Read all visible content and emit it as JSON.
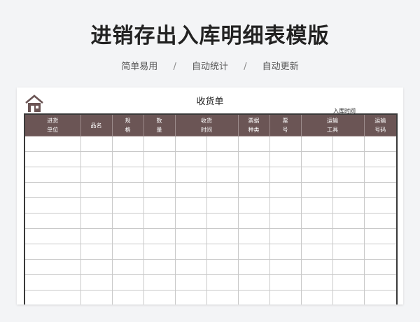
{
  "header": {
    "title": "进销存出入库明细表模版",
    "tags": [
      "简单易用",
      "自动统计",
      "自动更新"
    ],
    "separator": "/"
  },
  "sheet": {
    "title": "收货单",
    "time_label": "入库时间",
    "columns": [
      {
        "line1": "进货",
        "line2": "单位"
      },
      {
        "line1": "品名",
        "line2": ""
      },
      {
        "line1": "规",
        "line2": "格"
      },
      {
        "line1": "数",
        "line2": "量"
      },
      {
        "line1": "收货",
        "line2": "时间",
        "colspan": 2
      },
      {
        "line1": "票据",
        "line2": "种类"
      },
      {
        "line1": "票",
        "line2": "号"
      },
      {
        "line1": "运输",
        "line2": "工具",
        "colspan": 2
      },
      {
        "line1": "运输",
        "line2": "号码"
      }
    ],
    "empty_rows": 11
  },
  "colors": {
    "header_bg": "#6b5555",
    "icon": "#6b5555"
  }
}
